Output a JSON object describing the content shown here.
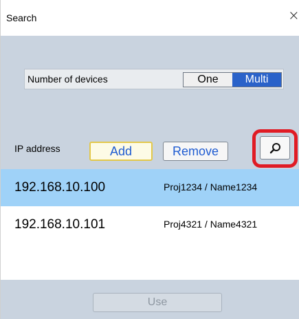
{
  "window": {
    "title": "Search",
    "close_glyph": "×"
  },
  "devices": {
    "label": "Number of devices",
    "options": [
      "One",
      "Multi"
    ],
    "selected": "Multi"
  },
  "ip": {
    "label": "IP address",
    "add_label": "Add",
    "remove_label": "Remove",
    "search_icon": "search-icon",
    "highlight_color": "#e01b24"
  },
  "list": {
    "items": [
      {
        "ip": "192.168.10.100",
        "proj": "Proj1234 / Name1234",
        "selected": true
      },
      {
        "ip": "192.168.10.101",
        "proj": "Proj4321 / Name4321",
        "selected": false
      }
    ]
  },
  "footer": {
    "use_label": "Use",
    "use_enabled": false
  },
  "colors": {
    "selected_row": "#9fd2f8",
    "accent": "#2a62c9",
    "panel": "#c9d3df"
  }
}
